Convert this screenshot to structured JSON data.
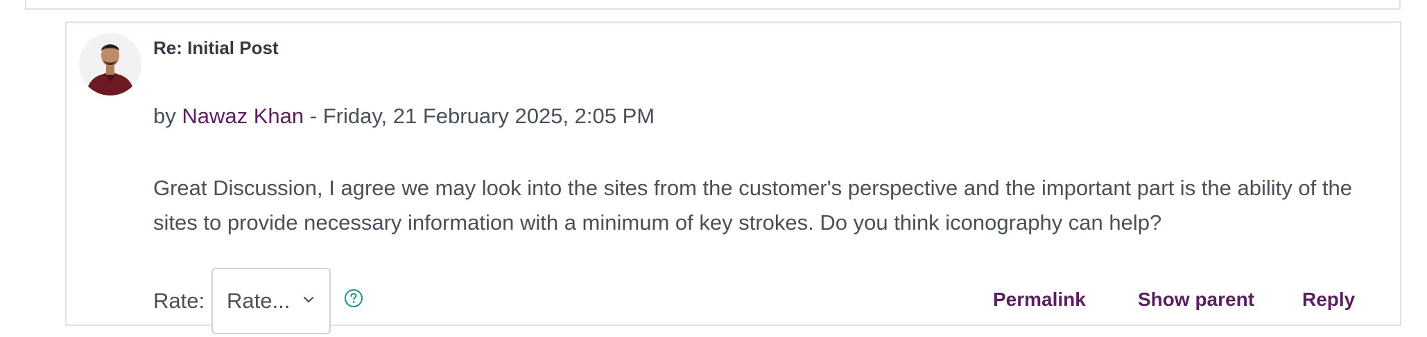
{
  "post": {
    "title": "Re: Initial Post",
    "meta_prefix": "by ",
    "author": "Nawaz Khan",
    "meta_date": " - Friday, 21 February 2025, 2:05 PM",
    "body": "Great Discussion, I agree we may look into the sites from the customer's perspective and the important part is the ability of the sites to provide necessary information with a minimum of key strokes. Do you think iconography can help?"
  },
  "rating": {
    "label": "Rate:",
    "selected": "Rate..."
  },
  "actions": {
    "permalink": "Permalink",
    "show_parent": "Show parent",
    "reply": "Reply"
  },
  "icons": {
    "avatar": "user-avatar-photo",
    "select_arrow": "chevron-down-icon",
    "help": "question-circle-icon"
  },
  "colors": {
    "link": "#5b1e5f",
    "text": "#495057",
    "title": "#343a40",
    "help_icon": "#1f8f8f",
    "border": "#dee2e6"
  }
}
